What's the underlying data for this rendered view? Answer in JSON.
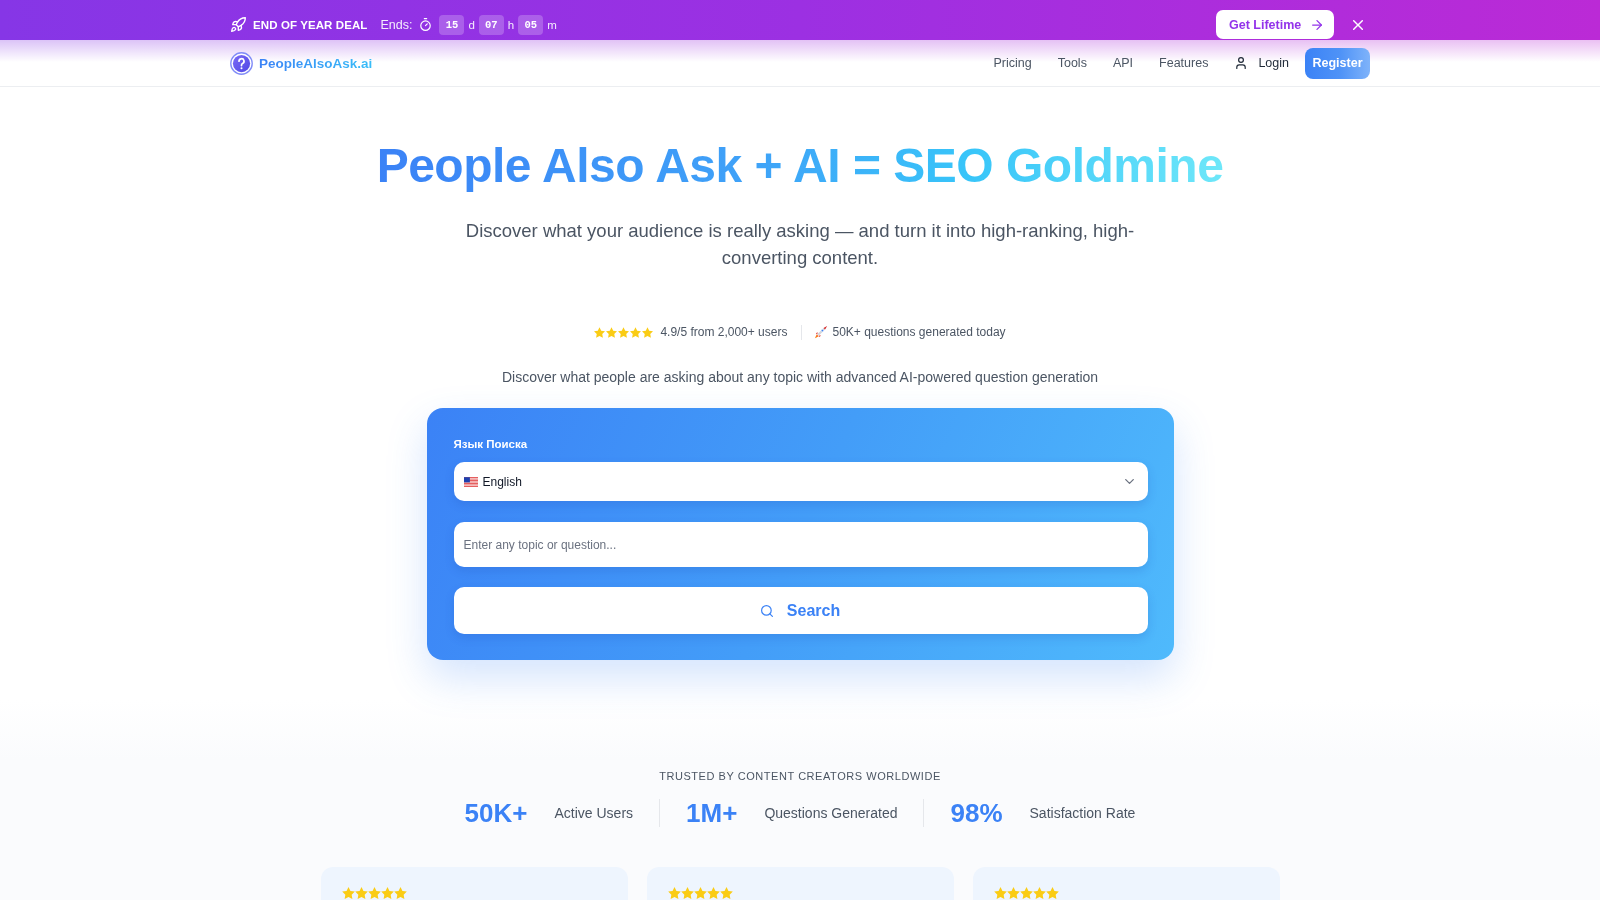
{
  "promo_bar": {
    "title": "END OF YEAR DEAL",
    "ends_label": "Ends:",
    "countdown": [
      {
        "value": "15",
        "unit": "d"
      },
      {
        "value": "07",
        "unit": "h"
      },
      {
        "value": "05",
        "unit": "m"
      }
    ],
    "cta": "Get Lifetime"
  },
  "nav": {
    "logo": "PeopleAlsoAsk.ai",
    "links": [
      "Pricing",
      "Tools",
      "API",
      "Features"
    ],
    "login": "Login",
    "register": "Register"
  },
  "hero": {
    "title": "People Also Ask + AI = SEO Goldmine",
    "subtitle": "Discover what your audience is really asking — and turn it into high-ranking, high-converting content.",
    "rating": {
      "stars": 5,
      "text": "4.9/5 from 2,000+ users"
    },
    "activity": "50K+ questions generated today",
    "description": "Discover what people are asking about any topic with advanced AI-powered question generation"
  },
  "search_form": {
    "language": {
      "label": "Язык Поиска",
      "value": "English"
    },
    "query": {
      "placeholder": "Enter any topic or question..."
    },
    "button": "Search"
  },
  "trust": {
    "heading": "TRUSTED BY CONTENT CREATORS WORLDWIDE",
    "stats": [
      {
        "value": "50K+",
        "label": "Active Users"
      },
      {
        "value": "1M+",
        "label": "Questions Generated"
      },
      {
        "value": "98%",
        "label": "Satisfaction Rate"
      }
    ]
  },
  "testimonials": [
    {
      "stars": 5
    },
    {
      "stars": 5
    },
    {
      "stars": 5
    }
  ]
}
